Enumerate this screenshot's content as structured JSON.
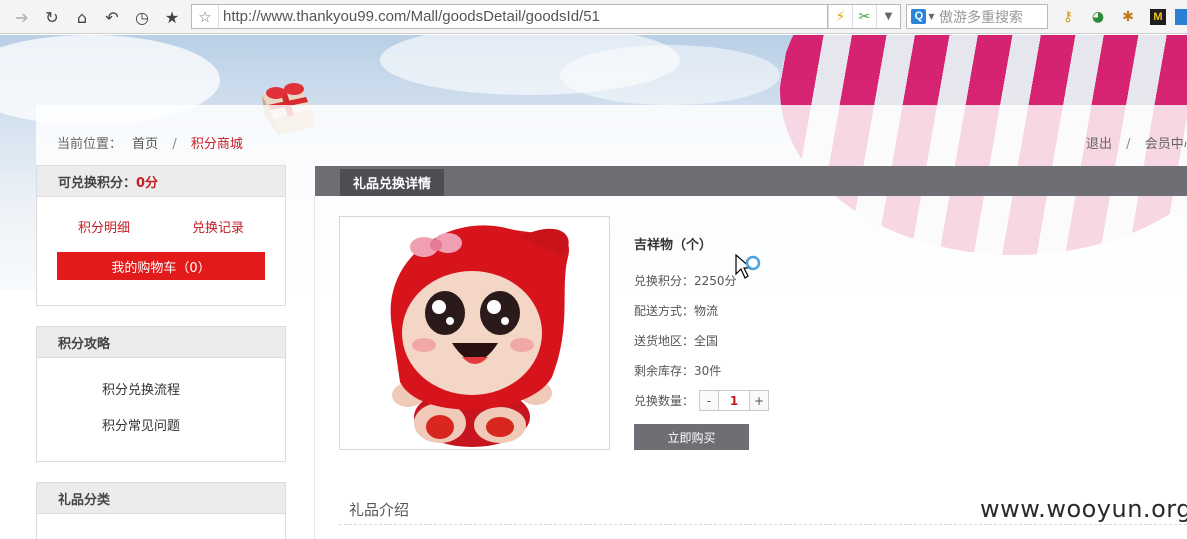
{
  "browser": {
    "url": "http://www.thankyou99.com/Mall/goodsDetail/goodsId/51",
    "search_placeholder": "傲游多重搜索",
    "search_engine_badge": "Q",
    "extension_label": "M"
  },
  "site": {
    "breadcrumb_prefix": "当前位置：",
    "breadcrumb_home": "首页",
    "breadcrumb_sep": "/",
    "breadcrumb_current": "积分商城",
    "logout": "退出",
    "member_center": "会员中心"
  },
  "sidebar": {
    "points_label": "可兑换积分：",
    "points_value": "0分",
    "points_detail_link": "积分明细",
    "exchange_record_link": "兑换记录",
    "cart_button": "我的购物车（0）",
    "guide_title": "积分攻略",
    "guide_items": [
      "积分兑换流程",
      "积分常见问题"
    ],
    "category_title": "礼品分类"
  },
  "main": {
    "tab_label": "礼品兑换详情",
    "product_name": "吉祥物（个）",
    "points_line": "兑换积分：2250分",
    "delivery_line": "配送方式：物流",
    "region_line": "送货地区：全国",
    "stock_line": "剩余库存：30件",
    "quantity_label": "兑换数量：",
    "quantity_minus": "-",
    "quantity_value": "1",
    "quantity_plus": "+",
    "buy_button": "立即购买",
    "intro_title": "礼品介绍"
  },
  "watermark": "www.wooyun.org",
  "colors": {
    "accent_red": "#c41d22",
    "cart_red": "#e21a1a",
    "header_gray": "#6d6f74"
  }
}
